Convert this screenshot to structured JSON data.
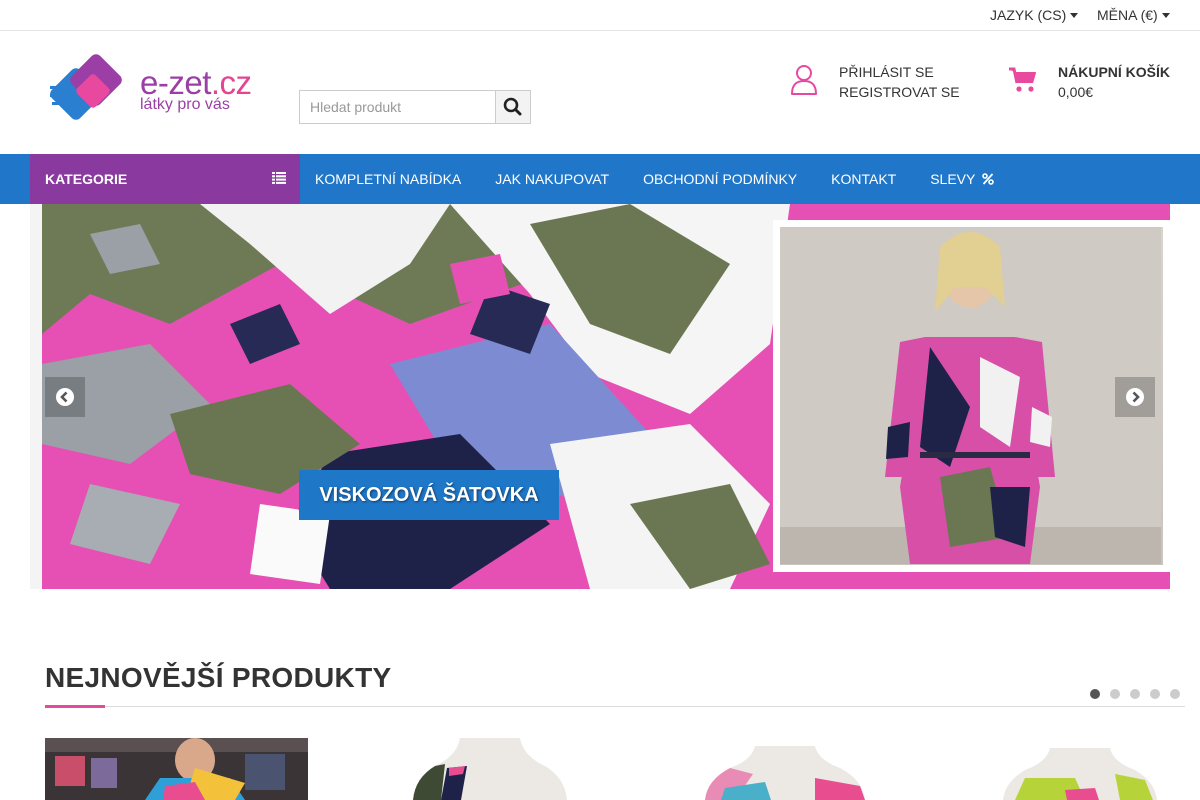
{
  "topbar": {
    "language": "JAZYK (CS)",
    "currency": "MĚNA (€)"
  },
  "logo": {
    "name": "e-zet",
    "tld": ".cz",
    "tagline": "látky pro vás"
  },
  "search": {
    "placeholder": "Hledat produkt",
    "value": ""
  },
  "account": {
    "login": "PŘIHLÁSIT SE",
    "register": "REGISTROVAT SE"
  },
  "cart": {
    "title": "NÁKUPNÍ KOŠÍK",
    "total": "0,00€"
  },
  "nav": {
    "category": "KATEGORIE",
    "links": [
      {
        "label": "KOMPLETNÍ NABÍDKA"
      },
      {
        "label": "JAK NAKUPOVAT"
      },
      {
        "label": "OBCHODNÍ PODMÍNKY"
      },
      {
        "label": "KONTAKT"
      },
      {
        "label": "SLEVY"
      }
    ]
  },
  "banner": {
    "label": "VISKOZOVÁ ŠATOVKA"
  },
  "section": {
    "title": "NEJNOVĚJŠÍ PRODUKTY",
    "dots_total": 5,
    "active_dot": 1
  },
  "icons": {
    "search": "search-icon",
    "user": "user-icon",
    "cart": "cart-icon",
    "categories": "list-icon",
    "discount": "percent-icon",
    "prev": "chevron-left-icon",
    "next": "chevron-right-icon"
  },
  "colors": {
    "nav_blue": "#2077c9",
    "category_purple": "#8a3a9e",
    "accent_pink": "#e8499f",
    "logo_purple": "#9b3fa6"
  }
}
